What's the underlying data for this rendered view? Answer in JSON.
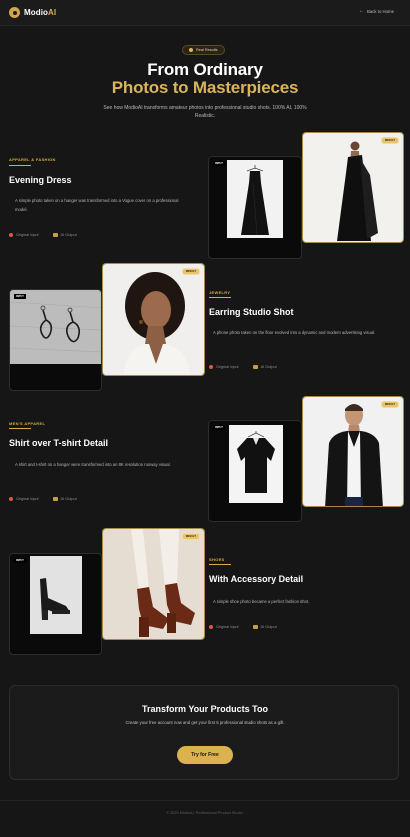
{
  "header": {
    "brand_main": "Modio",
    "brand_accent": "AI",
    "back_label": "Back to Home"
  },
  "hero": {
    "badge": "Real Results",
    "title_line1": "From Ordinary",
    "title_line2": "Photos to Masterpieces",
    "subtitle": "See how ModioAI transforms amateur photos into professional studio shots. 100% AI, 100% Realistic."
  },
  "labels": {
    "input_badge": "INPUT",
    "result_badge": "RESULT",
    "original_input": "Original Input",
    "ai_output": "AI Output"
  },
  "sections": [
    {
      "category": "APPAREL & FASHION",
      "title": "Evening Dress",
      "description": "A simple photo taken on a hanger was transformed into a Vogue cover on a professional model."
    },
    {
      "category": "JEWELRY",
      "title": "Earring Studio Shot",
      "description": "A phone photo taken on the floor evolved into a dynamic and modern advertising visual."
    },
    {
      "category": "MEN'S APPAREL",
      "title": "Shirt over T-shirt Detail",
      "description": "A shirt and t-shirt on a hanger were transformed into an 8K resolution runway visual."
    },
    {
      "category": "SHOES",
      "title": "With Accessory Detail",
      "description": "A simple shoe photo became a perfect fashion shot."
    }
  ],
  "cta": {
    "title": "Transform Your Products Too",
    "subtitle": "Create your free account now and get your first 5 professional studio shots as a gift.",
    "button": "Try for Free"
  },
  "footer": {
    "text": "© 2025 ModioAI. Professional Product Studio."
  },
  "colors": {
    "accent": "#d9b45c",
    "background": "#161616",
    "card_border": "#a58a48"
  }
}
